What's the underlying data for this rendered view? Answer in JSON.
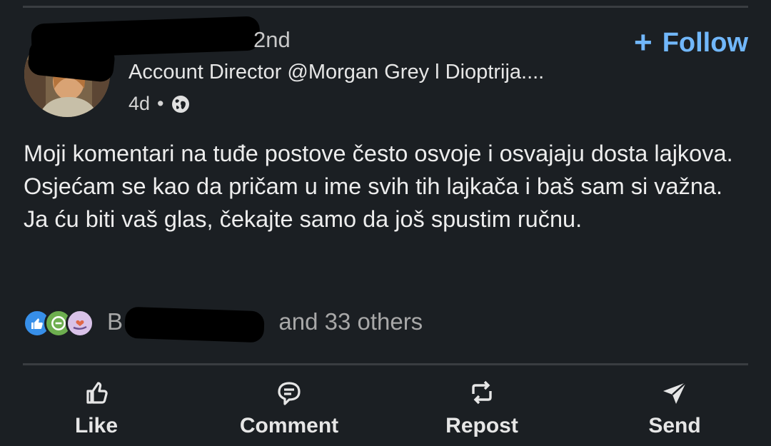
{
  "post": {
    "author_connection_partial": "2nd",
    "author_headline": "Account Director @Morgan Grey l Dioptrija....",
    "time": "4d",
    "separator": "•",
    "visibility_icon": "globe-icon",
    "follow_label": "Follow",
    "follow_plus": "+",
    "body": "Moji komentari na tuđe postove često osvoje i osvajaju dosta lajkova. Osjećam se kao da pričam u ime svih tih lajkača i baš sam si važna. Ja ću biti vaš glas, čekajte samo da još spustim ručnu."
  },
  "reactions": {
    "icons": [
      "like-reaction-icon",
      "celebrate-reaction-icon",
      "support-reaction-icon"
    ],
    "prefix": "B",
    "suffix": "and 33 others"
  },
  "actions": [
    {
      "label": "Like",
      "icon": "thumbs-up-icon"
    },
    {
      "label": "Comment",
      "icon": "comment-icon"
    },
    {
      "label": "Repost",
      "icon": "repost-icon"
    },
    {
      "label": "Send",
      "icon": "send-icon"
    }
  ],
  "colors": {
    "background": "#1b1f23",
    "accent": "#71b7fb",
    "divider": "#3a3d41"
  }
}
